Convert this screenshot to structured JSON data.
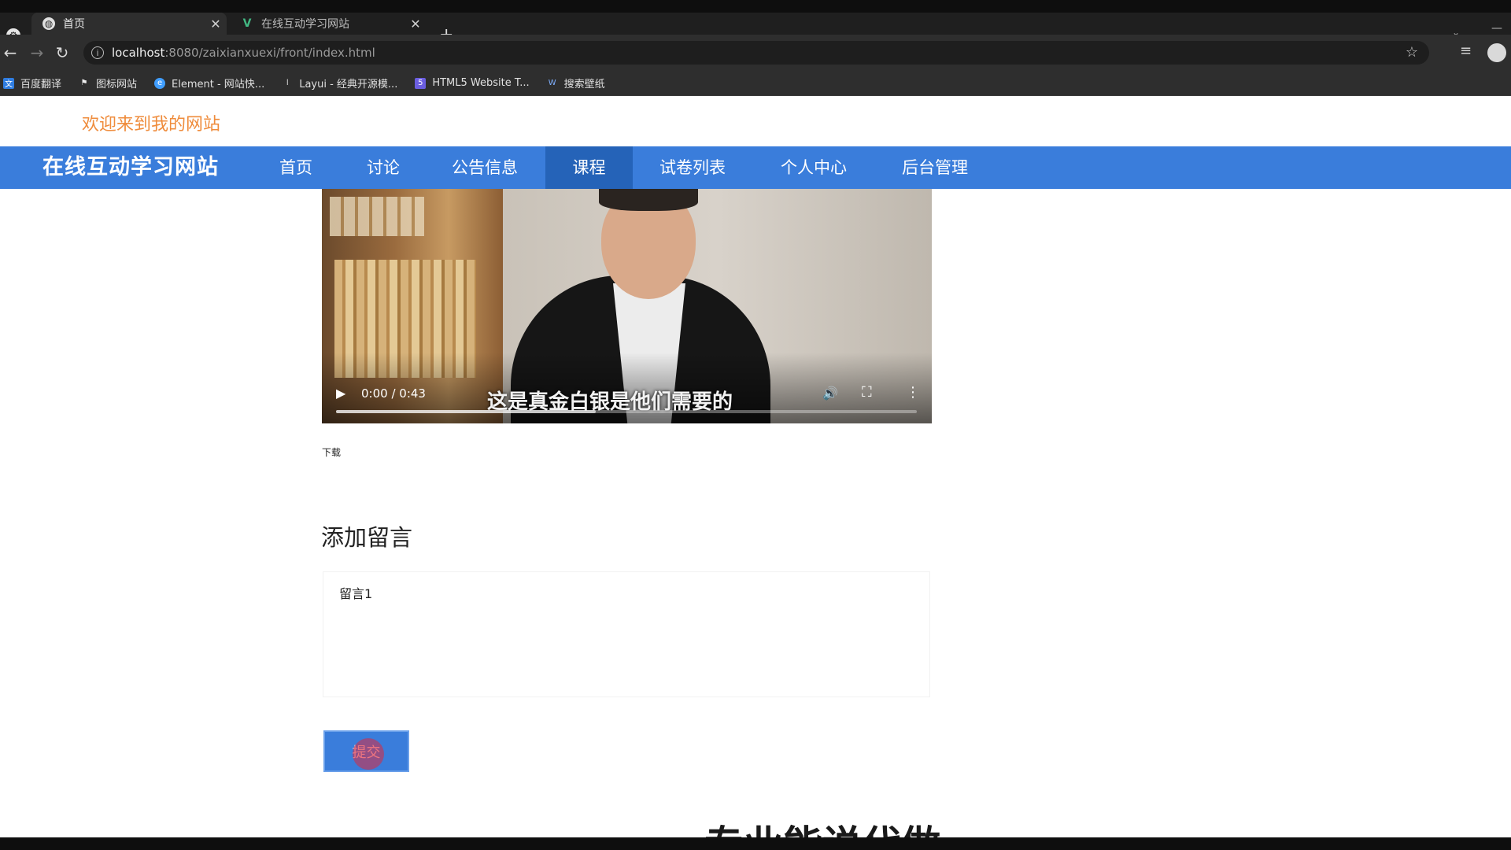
{
  "browser": {
    "tabs": [
      {
        "title": "首页",
        "active": true
      },
      {
        "title": "在线互动学习网站",
        "active": false
      }
    ],
    "url_host": "localhost",
    "url_rest": ":8080/zaixianxuexi/front/index.html",
    "bookmarks": [
      {
        "label": "百度翻译",
        "icon": "translate-icon"
      },
      {
        "label": "图标网站",
        "icon": "flag-icon"
      },
      {
        "label": "Element - 网站快...",
        "icon": "element-logo-icon"
      },
      {
        "label": "Layui - 经典开源模...",
        "icon": "layui-logo-icon"
      },
      {
        "label": "HTML5 Website T...",
        "icon": "html5-logo-icon"
      },
      {
        "label": "搜索壁纸",
        "icon": "wallpaper-icon"
      }
    ]
  },
  "site": {
    "welcome": "欢迎来到我的网站",
    "title": "在线互动学习网站",
    "nav": [
      {
        "label": "首页",
        "active": false
      },
      {
        "label": "讨论",
        "active": false
      },
      {
        "label": "公告信息",
        "active": false
      },
      {
        "label": "课程",
        "active": true
      },
      {
        "label": "试卷列表",
        "active": false
      },
      {
        "label": "个人中心",
        "active": false
      },
      {
        "label": "后台管理",
        "active": false
      }
    ]
  },
  "video": {
    "time": "0:00 / 0:43",
    "subtitle": "这是真金白银是他们需要的"
  },
  "download_label": "下载",
  "comment": {
    "heading": "添加留言",
    "value": "留言1",
    "submit_label": "提交"
  },
  "bottom_heading": "专业能说代做",
  "colors": {
    "nav_bg": "#3a7ddb",
    "nav_active": "#2563b8",
    "welcome": "#ef8c3c"
  }
}
